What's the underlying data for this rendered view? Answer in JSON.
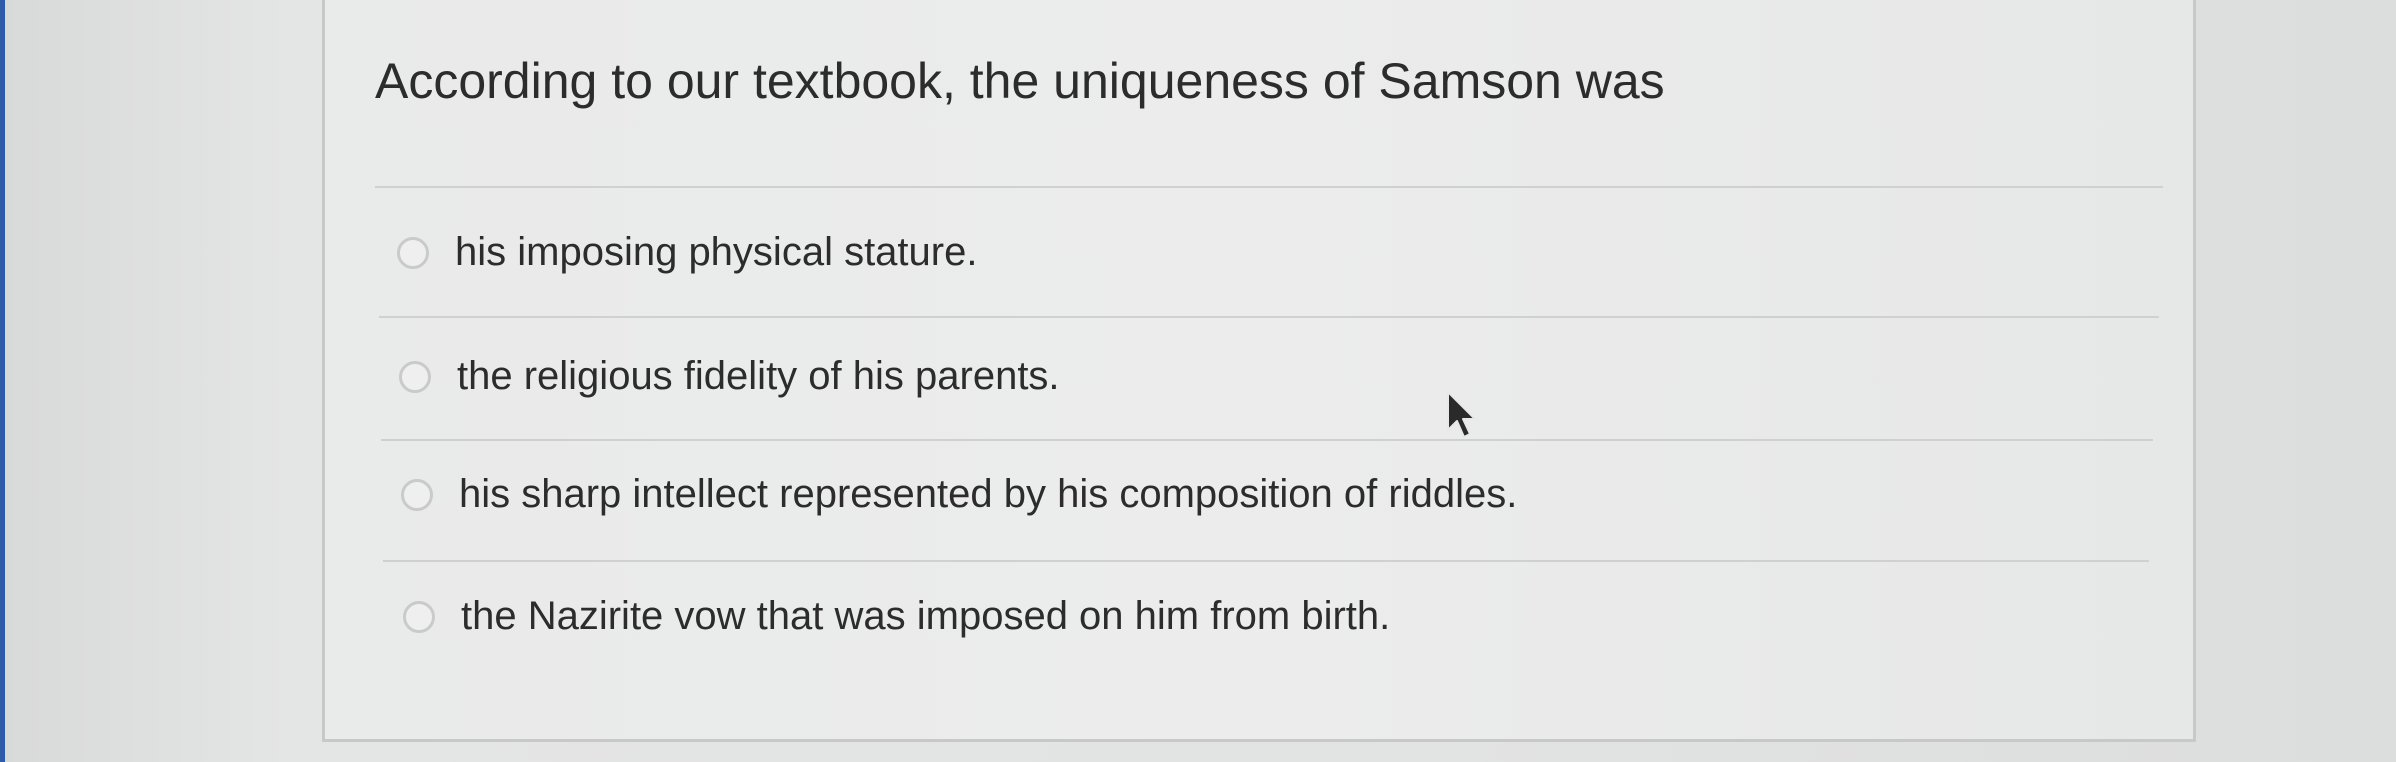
{
  "question": {
    "text": "According to our textbook, the uniqueness of Samson was"
  },
  "options": [
    {
      "label": "his imposing physical stature.",
      "selected": false
    },
    {
      "label": "the religious fidelity of his parents.",
      "selected": false
    },
    {
      "label": "his sharp intellect represented by his composition of riddles.",
      "selected": false
    },
    {
      "label": "the Nazirite vow that was imposed on him from birth.",
      "selected": false
    }
  ],
  "icons": {
    "radio": "radio-unselected-icon",
    "pointer": "mouse-pointer-icon"
  },
  "colors": {
    "text": "#2c2c2c",
    "card_background": "#ececec",
    "divider": "#cfd0d0",
    "radio_border": "#c9cacb",
    "left_edge_accent": "#2d5ca8"
  }
}
